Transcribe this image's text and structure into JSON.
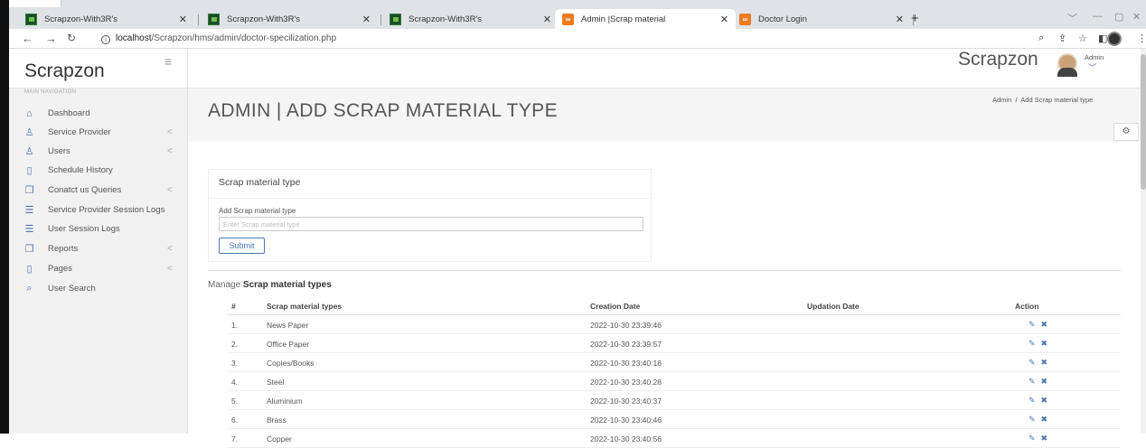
{
  "browser": {
    "tabs": [
      {
        "label": "Scrapzon-With3R's",
        "favicon": "green"
      },
      {
        "label": "Scrapzon-With3R's",
        "favicon": "green"
      },
      {
        "label": "Scrapzon-With3R's",
        "favicon": "green"
      },
      {
        "label": "Admin |Scrap material",
        "favicon": "orange"
      },
      {
        "label": "Doctor Login",
        "favicon": "orange"
      }
    ],
    "url_host": "localhost",
    "url_path": "/Scrapzon/hms/admin/doctor-specilization.php"
  },
  "sidebar": {
    "brand": "Scrapzon",
    "nav_heading": "MAIN NAVIGATION",
    "items": [
      {
        "label": "Dashboard",
        "icon": "home-icon",
        "has_arrow": false
      },
      {
        "label": "Service Provider",
        "icon": "user-icon",
        "has_arrow": true
      },
      {
        "label": "Users",
        "icon": "user-icon",
        "has_arrow": true
      },
      {
        "label": "Schedule History",
        "icon": "file-icon",
        "has_arrow": false
      },
      {
        "label": "Conatct us Queries",
        "icon": "files-icon",
        "has_arrow": true
      },
      {
        "label": "Service Provider Session Logs",
        "icon": "list-icon",
        "has_arrow": false
      },
      {
        "label": "User Session Logs",
        "icon": "list-icon",
        "has_arrow": false
      },
      {
        "label": "Reports",
        "icon": "files-icon",
        "has_arrow": true
      },
      {
        "label": "Pages",
        "icon": "file-icon",
        "has_arrow": true
      },
      {
        "label": "User Search",
        "icon": "search-icon",
        "has_arrow": false
      }
    ]
  },
  "topnav": {
    "brand": "Scrapzon",
    "user": "Admin"
  },
  "header": {
    "title": "ADMIN | ADD SCRAP MATERIAL TYPE",
    "breadcrumb_root": "Admin",
    "breadcrumb_sep": "/",
    "breadcrumb_current": "Add Scrap material type"
  },
  "form": {
    "title": "Scrap material type",
    "label": "Add Scrap material type",
    "placeholder": "Enter Scrap material type",
    "submit": "Submit"
  },
  "manage": {
    "prefix": "Manage ",
    "bold": "Scrap material types",
    "columns": [
      "#",
      "Scrap material types",
      "Creation Date",
      "Updation Date",
      "Action"
    ],
    "rows": [
      {
        "num": "1.",
        "name": "News Paper",
        "created": "2022-10-30 23:39:46",
        "updated": ""
      },
      {
        "num": "2.",
        "name": "Office Paper",
        "created": "2022-10-30 23:39:57",
        "updated": ""
      },
      {
        "num": "3.",
        "name": "Copies/Books",
        "created": "2022-10-30 23:40:18",
        "updated": ""
      },
      {
        "num": "4.",
        "name": "Steel",
        "created": "2022-10-30 23:40:28",
        "updated": ""
      },
      {
        "num": "5.",
        "name": "Aluminium",
        "created": "2022-10-30 23:40:37",
        "updated": ""
      },
      {
        "num": "6.",
        "name": "Brass",
        "created": "2022-10-30 23:40:46",
        "updated": ""
      },
      {
        "num": "7.",
        "name": "Copper",
        "created": "2022-10-30 23:40:56",
        "updated": ""
      }
    ]
  },
  "colors": {
    "accent": "#4a76b8",
    "sidebar_bg": "#f1f1f1",
    "title_bg": "#f5f5f5"
  }
}
